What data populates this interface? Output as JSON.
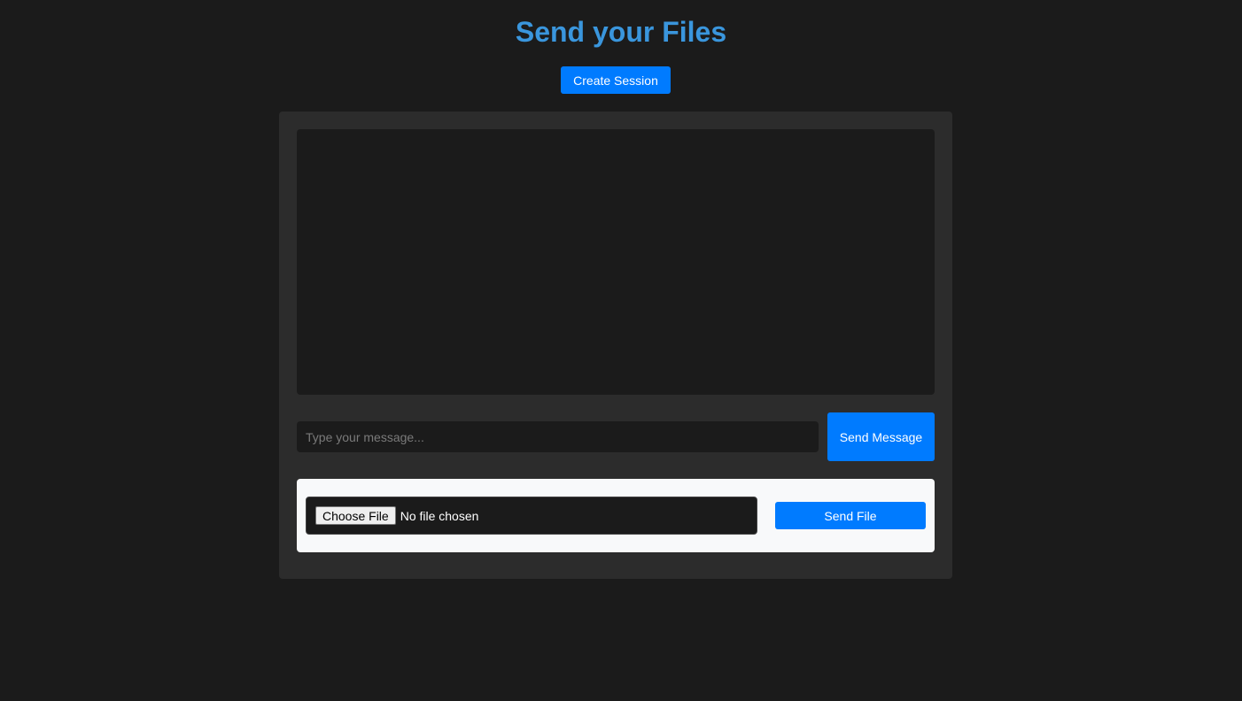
{
  "header": {
    "title": "Send your Files",
    "create_session_label": "Create Session"
  },
  "chat": {
    "message_placeholder": "Type your message...",
    "message_value": "",
    "send_message_label": "Send Message"
  },
  "file_upload": {
    "choose_file_label": "Choose File",
    "file_status": "No file chosen",
    "send_file_label": "Send File"
  },
  "colors": {
    "background": "#1b1b1b",
    "panel": "#2c2c2c",
    "accent": "#007bff",
    "title": "#3a96dd",
    "file_box": "#f8f9fa"
  }
}
